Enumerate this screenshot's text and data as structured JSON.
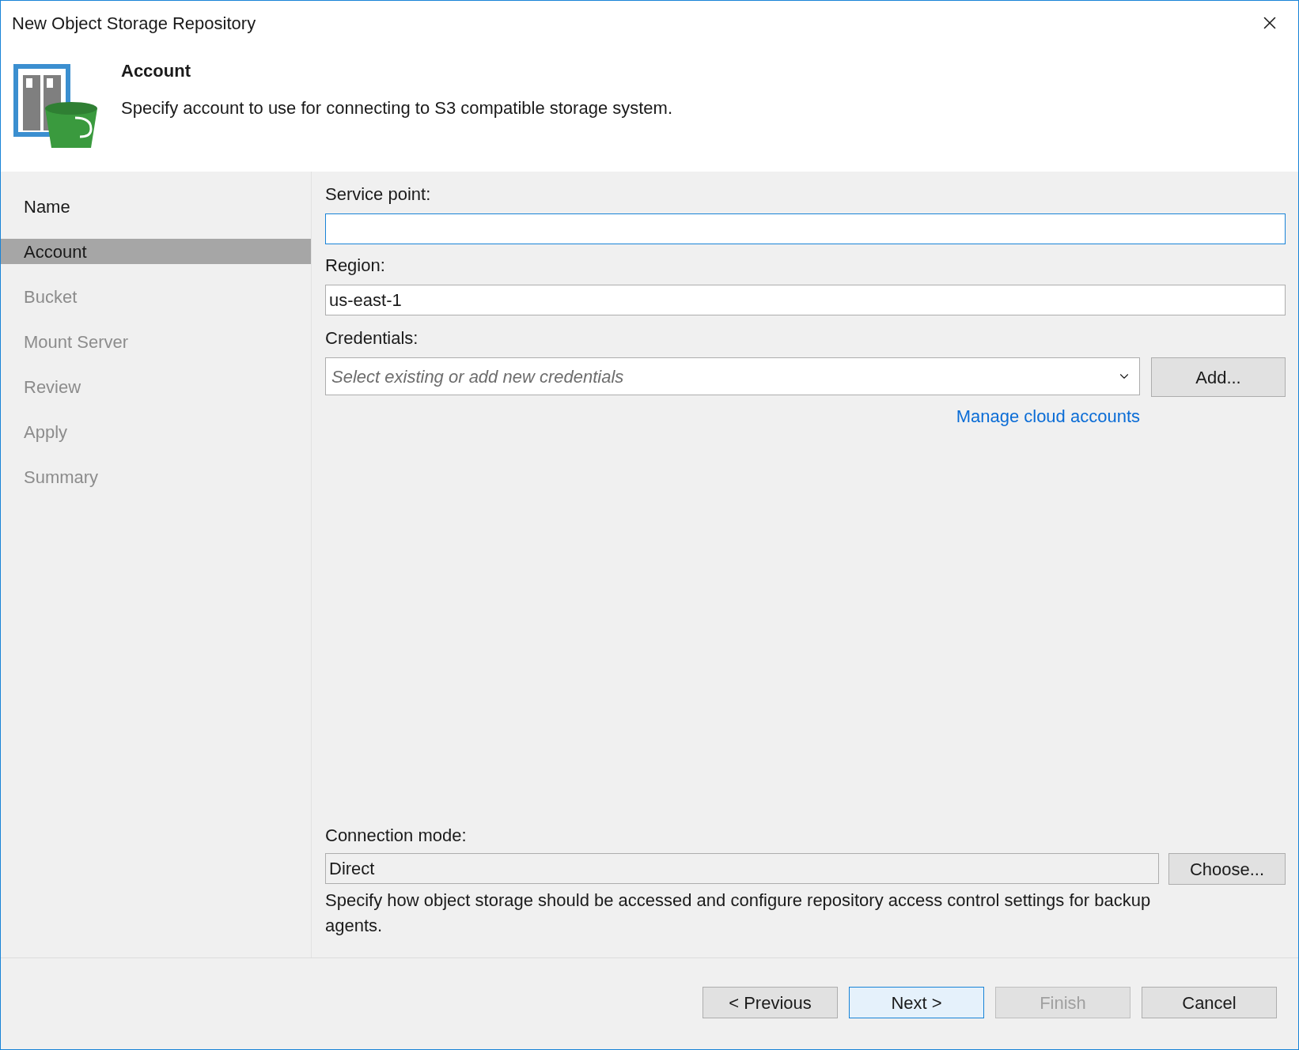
{
  "window": {
    "title": "New Object Storage Repository"
  },
  "header": {
    "title": "Account",
    "description": "Specify account to use for connecting to S3 compatible storage system."
  },
  "steps": [
    {
      "label": "Name",
      "selected": false,
      "disabled": false
    },
    {
      "label": "Account",
      "selected": true,
      "disabled": false
    },
    {
      "label": "Bucket",
      "selected": false,
      "disabled": true
    },
    {
      "label": "Mount Server",
      "selected": false,
      "disabled": true
    },
    {
      "label": "Review",
      "selected": false,
      "disabled": true
    },
    {
      "label": "Apply",
      "selected": false,
      "disabled": true
    },
    {
      "label": "Summary",
      "selected": false,
      "disabled": true
    }
  ],
  "service_point": {
    "label": "Service point:",
    "focused": true
  },
  "region": {
    "label": "Region:",
    "value": "us-east-1"
  },
  "credentials": {
    "label": "Credentials:",
    "placeholder": "Select existing or add new credentials",
    "button": "Add...",
    "link": "Manage cloud accounts"
  },
  "connection_mode": {
    "label": "Connection mode:",
    "value": "Direct",
    "button": "Choose...",
    "description": "Specify how object storage should be accessed and configure repository access control settings for backup agents."
  },
  "buttons": [
    {
      "label": "< Previous",
      "disabled": false,
      "default": false
    },
    {
      "label": "Next >",
      "disabled": false,
      "default": true
    },
    {
      "label": "Finish",
      "disabled": true,
      "default": false
    },
    {
      "label": "Cancel",
      "disabled": false,
      "default": false
    }
  ]
}
